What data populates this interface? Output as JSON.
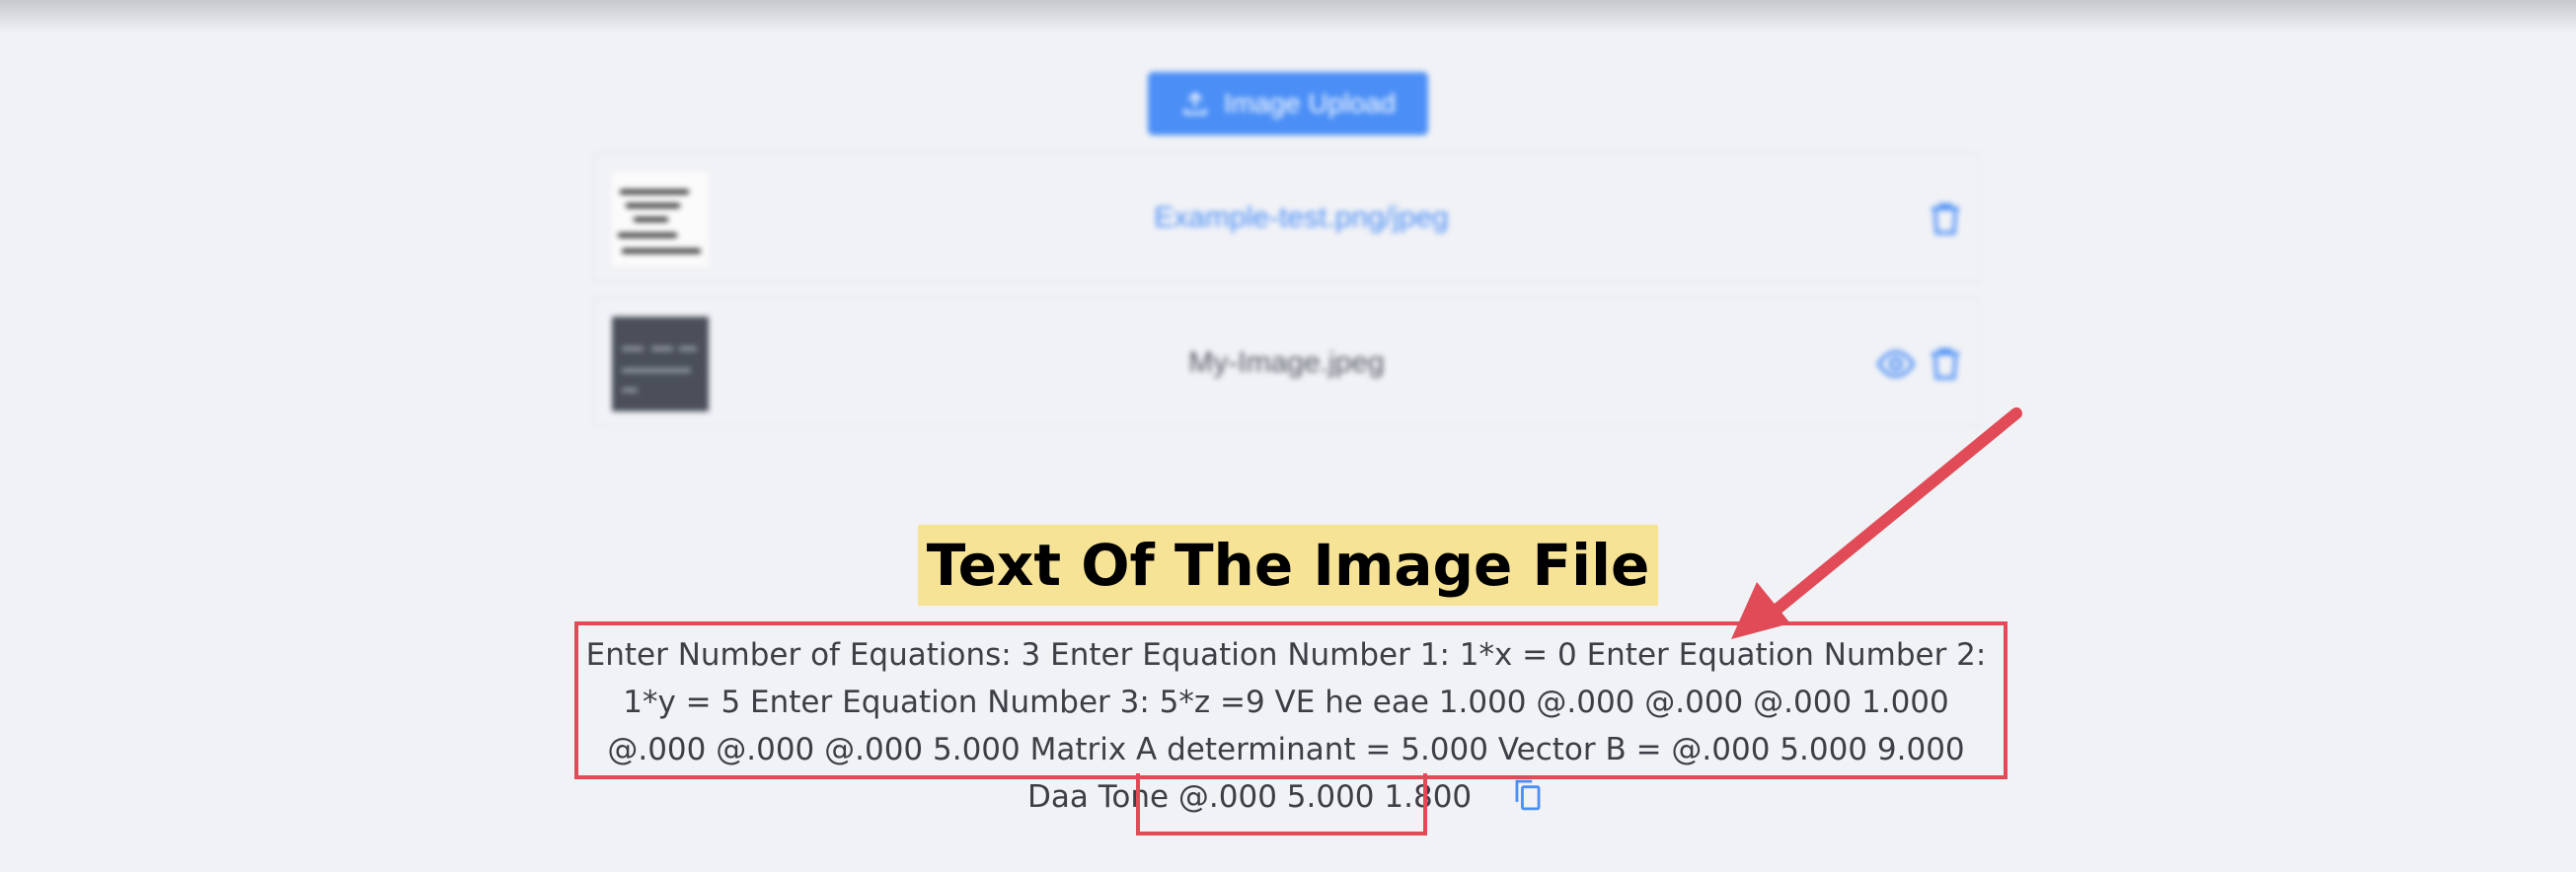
{
  "upload": {
    "button_label": "Image Upload",
    "icon": "upload-icon"
  },
  "files": [
    {
      "name": "Example-test.png/jpeg",
      "actions": [
        "trash-icon"
      ]
    },
    {
      "name": "My-Image.jpeg",
      "actions": [
        "eye-icon",
        "trash-icon"
      ]
    }
  ],
  "result": {
    "title": "Text Of The Image File",
    "text": "Enter Number of Equations: 3 Enter Equation Number 1: 1*x = 0 Enter Equation Number 2: 1*y = 5 Enter Equation Number 3: 5*z =9 VE he eae 1.000 @.000 @.000 @.000 1.000 @.000 @.000 @.000 5.000 Matrix A determinant = 5.000 Vector B = @.000 5.000 9.000 Daa Tone @.000 5.000 1.800",
    "copy_icon": "copy-icon"
  },
  "colors": {
    "accent": "#4a8ef6",
    "annotation": "#e04b57",
    "highlight": "#f6e395"
  }
}
